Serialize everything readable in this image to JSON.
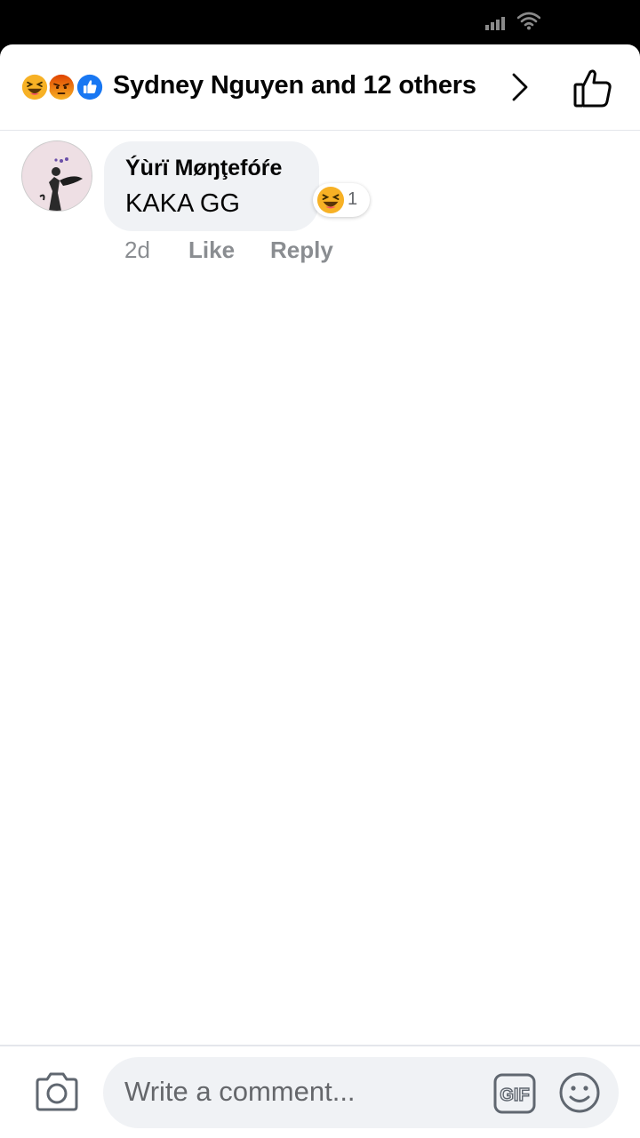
{
  "header": {
    "reaction_icons": [
      "haha-emoji-icon",
      "angry-emoji-icon",
      "like-reaction-icon"
    ],
    "title": "Sydney Nguyen and 12 others"
  },
  "comments": [
    {
      "author": "Ýùrï Møŋţefóŕe",
      "text": "KAKA GG",
      "reaction_count": "1",
      "reaction_icon": "haha-emoji-icon",
      "time": "2d",
      "like_label": "Like",
      "reply_label": "Reply"
    }
  ],
  "composer": {
    "placeholder": "Write a comment..."
  },
  "colors": {
    "text_primary": "#050505",
    "text_secondary": "#65676b",
    "bubble_bg": "#f0f2f5",
    "like_blue": "#1877f2",
    "angry_red": "#e9710f",
    "haha_yellow": "#f7b125"
  }
}
